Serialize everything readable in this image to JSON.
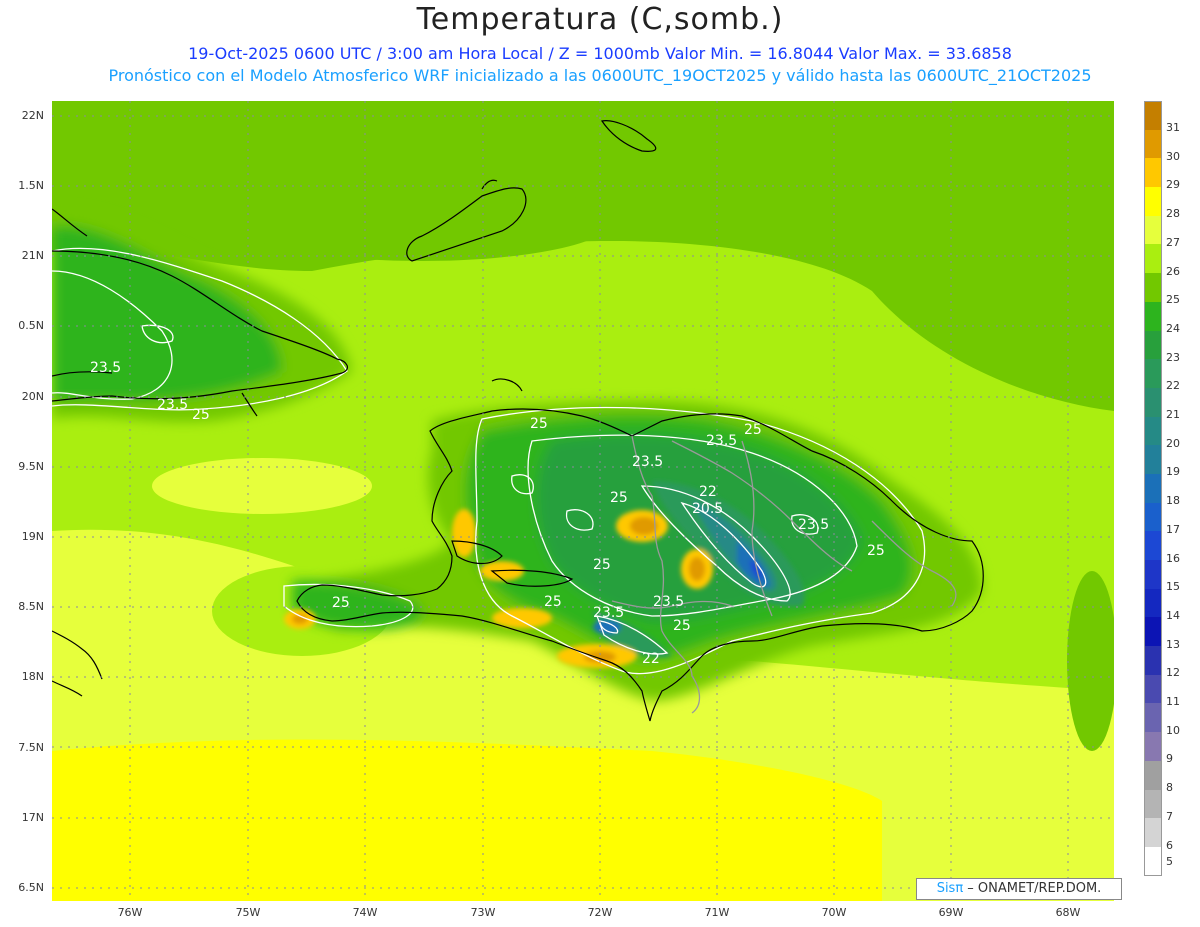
{
  "title": "Temperatura (C,somb.)",
  "subtitle_line1": "19-Oct-2025  0600 UTC / 3:00 am Hora Local / Z = 1000mb   Valor Min. = 16.8044  Valor Max. = 33.6858",
  "subtitle_line2": "Pronóstico con el Modelo Atmosferico WRF inicializado a las 0600UTC_19OCT2025 y válido hasta las  0600UTC_21OCT2025",
  "credit_prefix": "Sisπ",
  "credit_suffix": " – ONAMET/REP.DOM.",
  "lat_labels": [
    "22N",
    "1.5N",
    "21N",
    "0.5N",
    "20N",
    "9.5N",
    "19N",
    "8.5N",
    "18N",
    "7.5N",
    "17N",
    "6.5N"
  ],
  "lon_labels": [
    "76W",
    "75W",
    "74W",
    "73W",
    "72W",
    "71W",
    "70W",
    "69W",
    "68W"
  ],
  "contour_labels": [
    "23.5",
    "23.5",
    "25",
    "25",
    "23.5",
    "25",
    "23.5",
    "25",
    "22",
    "20.5",
    "23.5",
    "25",
    "25",
    "25",
    "23.5",
    "23.5",
    "25",
    "22",
    "25"
  ],
  "colorbar": {
    "labels": [
      "31",
      "30",
      "29",
      "28",
      "27",
      "26",
      "25",
      "24",
      "23",
      "22",
      "21",
      "20",
      "19",
      "18",
      "17",
      "16",
      "15",
      "14",
      "13",
      "12",
      "11",
      "10",
      "9",
      "8",
      "7",
      "6",
      "5"
    ],
    "colors": [
      "#c47f00",
      "#e09a00",
      "#ffc800",
      "#ffff00",
      "#e6ff3c",
      "#aaee10",
      "#72c800",
      "#2db41e",
      "#28a03c",
      "#2a9a5a",
      "#2a9070",
      "#258a86",
      "#22809a",
      "#1b70b8",
      "#1a60cc",
      "#1c48d4",
      "#1e36c8",
      "#1428c0",
      "#0c14b4",
      "#2a32b0",
      "#4a4ab0",
      "#6a64b0",
      "#8878b0",
      "#a0a0a0",
      "#b4b4b4",
      "#d4d4d4",
      "#ffffff"
    ]
  },
  "field_colors": {
    "sea_main": "#aaee10",
    "sea_north": "#72c800",
    "sea_south": "#ffff00",
    "sea_band": "#e6ff3c",
    "land_26": "#72c800",
    "land_24": "#2db41e",
    "land_23": "#28a03c",
    "land_22": "#2a9a5a",
    "mountain_20": "#258a86",
    "mountain_18": "#1b70b8",
    "mountain_16": "#1c48d4",
    "hot_29": "#ffc800",
    "hot_30": "#e09a00",
    "coast": "#000000",
    "border": "#9a9a9a",
    "contour": "#ffffff"
  }
}
